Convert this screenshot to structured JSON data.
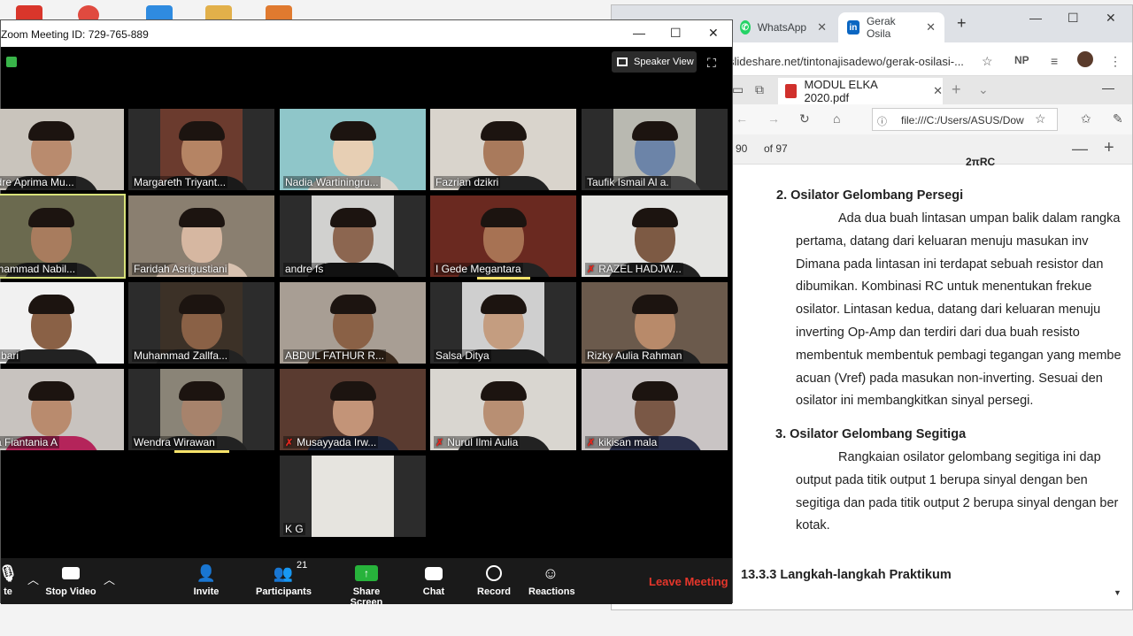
{
  "zoom": {
    "title": "Zoom Meeting ID: 729-765-889",
    "speaker_view": "Speaker View",
    "participants": [
      {
        "name": "Andre Aprima Mu..."
      },
      {
        "name": "Margareth Triyant..."
      },
      {
        "name": "Nadia Wartiningru..."
      },
      {
        "name": "Fazrian dzikri"
      },
      {
        "name": "Taufik Ismail Al a."
      },
      {
        "name": "Muhammad Nabil..."
      },
      {
        "name": "Faridah Asrigustiani"
      },
      {
        "name": "andre fs"
      },
      {
        "name": "I Gede Megantara"
      },
      {
        "name": "RAZEL HADJW..."
      },
      {
        "name": "n Albari"
      },
      {
        "name": "Muhammad Zallfa..."
      },
      {
        "name": "ABDUL FATHUR R..."
      },
      {
        "name": "Salsa Ditya"
      },
      {
        "name": "Rizky Aulia Rahman"
      },
      {
        "name": "Nila Fiantania A"
      },
      {
        "name": "Wendra Wirawan"
      },
      {
        "name": "Musayyada Irw..."
      },
      {
        "name": "Nurul Ilmi Aulia"
      },
      {
        "name": "kikisan mala"
      },
      {
        "name": "K G"
      }
    ],
    "toolbar": {
      "mute": "te",
      "stop_video": "Stop Video",
      "invite": "Invite",
      "participants": "Participants",
      "participants_count": "21",
      "share_screen": "Share Screen",
      "chat": "Chat",
      "record": "Record",
      "reactions": "Reactions",
      "leave": "Leave Meeting"
    }
  },
  "browser": {
    "tabs": [
      "WhatsApp",
      "Gerak Osila"
    ],
    "url": "slideshare.net/tintonajisadewo/gerak-osilasi-...",
    "profile": "NP",
    "edge_tab": "MODUL ELKA 2020.pdf",
    "edge_url": "file:///C:/Users/ASUS/Dow",
    "page_current": "90",
    "page_total": "of 97"
  },
  "document": {
    "formula": "2πRC",
    "section2_title": "2.   Osilator Gelombang Persegi",
    "section2_lines": [
      "Ada dua buah lintasan umpan balik dalam rangka",
      "pertama, datang dari keluaran menuju masukan inv",
      "Dimana pada lintasan ini terdapat sebuah resistor dan",
      "dibumikan. Kombinasi RC untuk menentukan frekue",
      "osilator. Lintasan kedua, datang dari keluaran menuju",
      "inverting Op-Amp dan terdiri dari dua buah resisto",
      "membentuk membentuk pembagi tegangan yang membe",
      "acuan (Vref) pada masukan non-inverting. Sesuai den",
      "osilator ini membangkitkan sinyal persegi."
    ],
    "section3_title": "3.   Osilator Gelombang Segitiga",
    "section3_lines": [
      "Rangkaian osilator gelombang segitiga ini dap",
      "output pada titik output 1 berupa sinyal dengan ben",
      "segitiga dan pada titik output 2 berupa sinyal dengan ber",
      "kotak."
    ],
    "section_title_1333": "13.3.3  Langkah-langkah Praktikum"
  }
}
